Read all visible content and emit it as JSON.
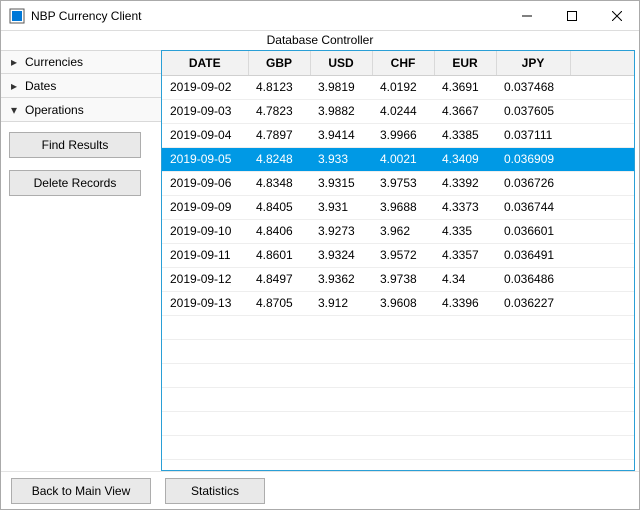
{
  "window": {
    "title": "NBP Currency Client",
    "subtitle": "Database Controller"
  },
  "sidebar": {
    "items": [
      {
        "label": "Currencies",
        "expanded": false
      },
      {
        "label": "Dates",
        "expanded": false
      },
      {
        "label": "Operations",
        "expanded": true
      }
    ],
    "buttons": {
      "find": "Find Results",
      "delete": "Delete Records"
    }
  },
  "table": {
    "columns": [
      "DATE",
      "GBP",
      "USD",
      "CHF",
      "EUR",
      "JPY"
    ],
    "selected_index": 3,
    "rows": [
      {
        "date": "2019-09-02",
        "gbp": "4.8123",
        "usd": "3.9819",
        "chf": "4.0192",
        "eur": "4.3691",
        "jpy": "0.037468"
      },
      {
        "date": "2019-09-03",
        "gbp": "4.7823",
        "usd": "3.9882",
        "chf": "4.0244",
        "eur": "4.3667",
        "jpy": "0.037605"
      },
      {
        "date": "2019-09-04",
        "gbp": "4.7897",
        "usd": "3.9414",
        "chf": "3.9966",
        "eur": "4.3385",
        "jpy": "0.037111"
      },
      {
        "date": "2019-09-05",
        "gbp": "4.8248",
        "usd": "3.933",
        "chf": "4.0021",
        "eur": "4.3409",
        "jpy": "0.036909"
      },
      {
        "date": "2019-09-06",
        "gbp": "4.8348",
        "usd": "3.9315",
        "chf": "3.9753",
        "eur": "4.3392",
        "jpy": "0.036726"
      },
      {
        "date": "2019-09-09",
        "gbp": "4.8405",
        "usd": "3.931",
        "chf": "3.9688",
        "eur": "4.3373",
        "jpy": "0.036744"
      },
      {
        "date": "2019-09-10",
        "gbp": "4.8406",
        "usd": "3.9273",
        "chf": "3.962",
        "eur": "4.335",
        "jpy": "0.036601"
      },
      {
        "date": "2019-09-11",
        "gbp": "4.8601",
        "usd": "3.9324",
        "chf": "3.9572",
        "eur": "4.3357",
        "jpy": "0.036491"
      },
      {
        "date": "2019-09-12",
        "gbp": "4.8497",
        "usd": "3.9362",
        "chf": "3.9738",
        "eur": "4.34",
        "jpy": "0.036486"
      },
      {
        "date": "2019-09-13",
        "gbp": "4.8705",
        "usd": "3.912",
        "chf": "3.9608",
        "eur": "4.3396",
        "jpy": "0.036227"
      }
    ],
    "empty_rows": 7
  },
  "footer": {
    "back": "Back to Main View",
    "stats": "Statistics"
  }
}
